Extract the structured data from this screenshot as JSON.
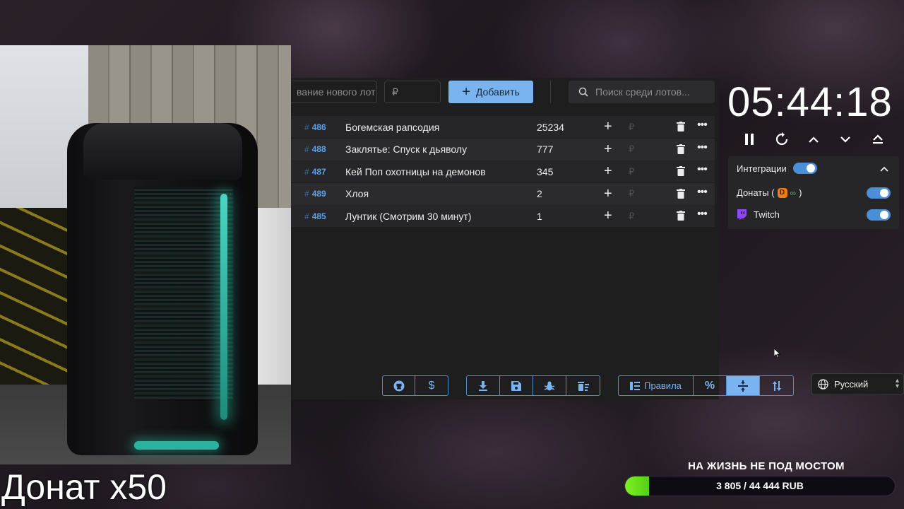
{
  "toolbar": {
    "name_placeholder": "вание нового лот",
    "sum_placeholder": "₽",
    "add_label": "Добавить",
    "search_placeholder": "Поиск среди лотов..."
  },
  "lots": [
    {
      "id": "486",
      "name": "Богемская рапсодия",
      "amount": "25234"
    },
    {
      "id": "488",
      "name": "Заклятье: Спуск к дьяволу",
      "amount": "777"
    },
    {
      "id": "487",
      "name": "Кей Поп охотницы на демонов",
      "amount": "345"
    },
    {
      "id": "489",
      "name": "Хлоя",
      "amount": "2"
    },
    {
      "id": "485",
      "name": "Лунтик (Смотрим 30 минут)",
      "amount": "1"
    }
  ],
  "lot_currency": "₽",
  "bottom": {
    "rules_label": "Правила"
  },
  "timer": {
    "value": "05:44:18"
  },
  "integrations": {
    "title": "Интеграции",
    "donations_label": "Донаты (",
    "donations_suffix": ")",
    "twitch_label": "Twitch"
  },
  "language": {
    "selected": "Русский"
  },
  "overlay": {
    "donate_multiplier": "Донат x50",
    "goal_title": "НА ЖИЗНЬ НЕ ПОД МОСТОМ",
    "goal_progress_text": "3 805 / 44 444 RUB",
    "goal_current": 3805,
    "goal_target": 44444
  },
  "colors": {
    "accent": "#7ab4f0",
    "panel_bg": "#1e1e1f",
    "goal_fill": "#7ff021",
    "twitch": "#9146ff",
    "donationalerts": "#f57d07"
  }
}
